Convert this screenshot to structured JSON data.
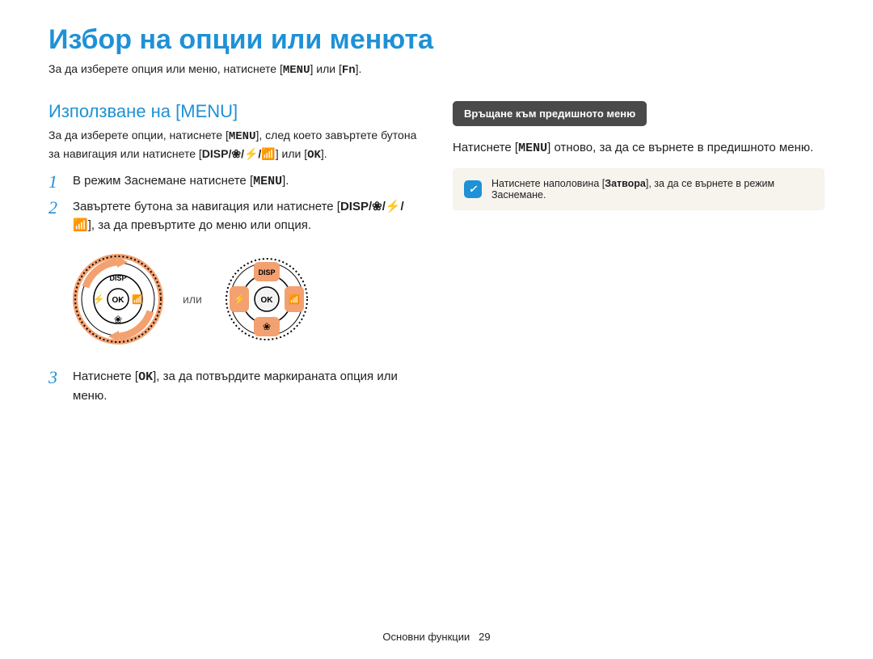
{
  "title": "Избор на опции или менюта",
  "intro_parts": {
    "p1": "За да изберете опция или меню, натиснете [",
    "m1": "MENU",
    "p2": "] или [",
    "m2": "Fn",
    "p3": "]."
  },
  "left": {
    "subheading": "Използване на [MENU]",
    "desc_parts": {
      "p1": "За да изберете опции, натиснете [",
      "m1": "MENU",
      "p2": "], след което завъртете бутона за навигация или натиснете [",
      "icons": "DISP/❀/⚡/📶",
      "p3": "] или [",
      "ok": "OK",
      "p4": "]."
    },
    "steps": [
      {
        "num": "1",
        "parts": {
          "p1": "В режим Заснемане натиснете [",
          "m1": "MENU",
          "p2": "]."
        }
      },
      {
        "num": "2",
        "parts": {
          "p1": "Завъртете бутона за навигация или натиснете [",
          "icons": "DISP/❀/⚡/📶",
          "p2": "], за да превъртите до меню или опция."
        }
      },
      {
        "num": "3",
        "parts": {
          "p1": "Натиснете [",
          "ok": "OK",
          "p2": "], за да потвърдите маркираната опция или меню."
        }
      }
    ],
    "figure_sep": "или",
    "dial": {
      "disp": "DISP",
      "ok": "OK"
    }
  },
  "right": {
    "pill": "Връщане към предишното меню",
    "body_parts": {
      "p1": "Натиснете [",
      "m1": "MENU",
      "p2": "] отново, за да се върнете в предишното меню."
    },
    "note_parts": {
      "p1": "Натиснете наполовина [",
      "b1": "Затвора",
      "p2": "], за да се върнете в режим Заснемане."
    }
  },
  "footer": {
    "section": "Основни функции",
    "page": "29"
  },
  "colors": {
    "accent": "#1f91d6",
    "dial_orange": "#f3a170",
    "note_bg": "#f7f3ed",
    "pill_bg": "#4a4a4a"
  }
}
